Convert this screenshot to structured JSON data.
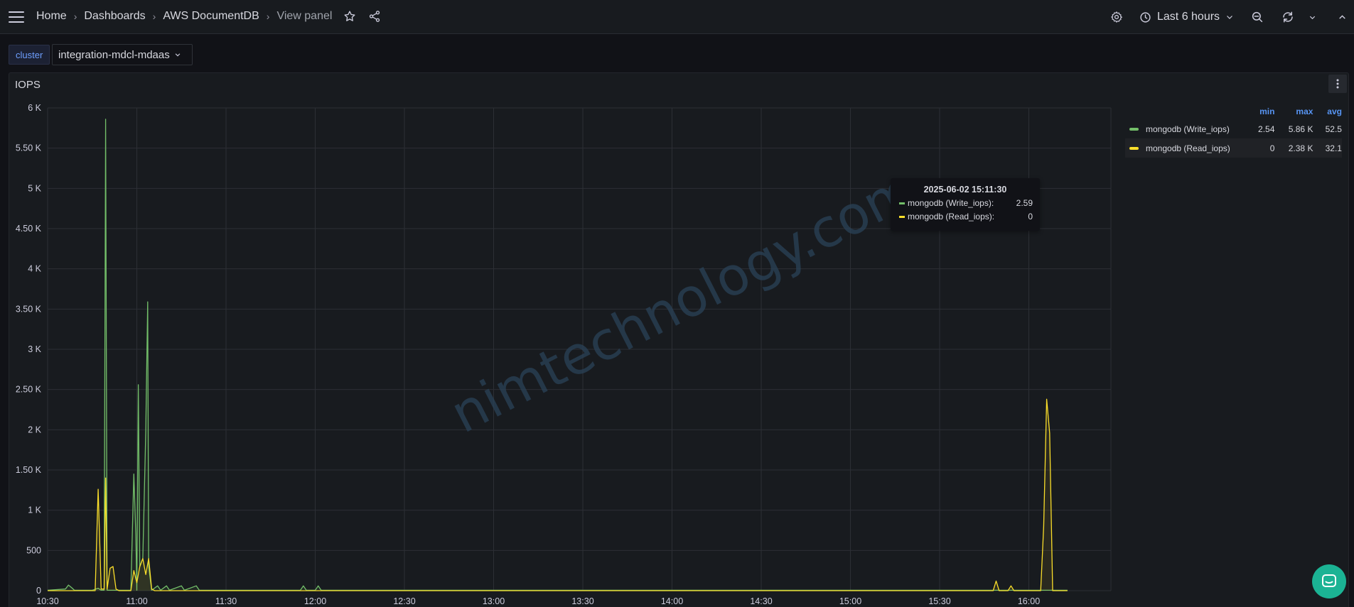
{
  "topbar": {
    "breadcrumbs": [
      {
        "label": "Home"
      },
      {
        "label": "Dashboards"
      },
      {
        "label": "AWS DocumentDB"
      },
      {
        "label": "View panel"
      }
    ],
    "time_range": "Last 6 hours"
  },
  "variables": {
    "label": "cluster",
    "value": "integration-mdcl-mdaas"
  },
  "panel": {
    "title": "IOPS"
  },
  "legend": {
    "headers": {
      "min": "min",
      "max": "max",
      "avg": "avg"
    },
    "rows": [
      {
        "name": "mongodb (Write_iops)",
        "min": "2.54",
        "max": "5.86 K",
        "avg": "52.5",
        "color": "#73bf69"
      },
      {
        "name": "mongodb (Read_iops)",
        "min": "0",
        "max": "2.38 K",
        "avg": "32.1",
        "color": "#fade2a"
      }
    ]
  },
  "tooltip": {
    "time": "2025-06-02 15:11:30",
    "rows": [
      {
        "name": "mongodb (Write_iops):",
        "value": "2.59",
        "color": "#73bf69"
      },
      {
        "name": "mongodb (Read_iops):",
        "value": "0",
        "color": "#fade2a"
      }
    ]
  },
  "watermark": "nimtechnology.com",
  "chart_data": {
    "type": "line",
    "x_tick_labels": [
      "10:30",
      "11:00",
      "11:30",
      "12:00",
      "12:30",
      "13:00",
      "13:30",
      "14:00",
      "14:30",
      "15:00",
      "15:30",
      "16:00"
    ],
    "y_tick_labels": [
      "0",
      "500",
      "1 K",
      "1.50 K",
      "2 K",
      "2.50 K",
      "3 K",
      "3.50 K",
      "4 K",
      "4.50 K",
      "5 K",
      "5.50 K",
      "6 K"
    ],
    "ylim": [
      0,
      6000
    ],
    "xlim": [
      "10:30",
      "16:15"
    ],
    "grid": true,
    "series": [
      {
        "name": "mongodb (Write_iops)",
        "color": "#73bf69",
        "points": [
          [
            "10:30",
            5
          ],
          [
            "10:36",
            20
          ],
          [
            "10:37",
            70
          ],
          [
            "10:38",
            40
          ],
          [
            "10:39",
            5
          ],
          [
            "10:45",
            5
          ],
          [
            "10:47",
            30
          ],
          [
            "10:48",
            5
          ],
          [
            "10:49",
            5
          ],
          [
            "10:49:30",
            5860
          ],
          [
            "10:50",
            5
          ],
          [
            "10:51",
            5
          ],
          [
            "10:58",
            5
          ],
          [
            "10:59",
            1450
          ],
          [
            "10:59:40",
            700
          ],
          [
            "11:00",
            5
          ],
          [
            "11:00:30",
            2560
          ],
          [
            "11:01",
            300
          ],
          [
            "11:02",
            400
          ],
          [
            "11:03",
            1990
          ],
          [
            "11:03:40",
            3590
          ],
          [
            "11:04",
            300
          ],
          [
            "11:05",
            5
          ],
          [
            "11:07",
            60
          ],
          [
            "11:08",
            5
          ],
          [
            "11:10",
            60
          ],
          [
            "11:11",
            5
          ],
          [
            "11:15",
            60
          ],
          [
            "11:16",
            5
          ],
          [
            "11:20",
            60
          ],
          [
            "11:21",
            5
          ],
          [
            "11:55",
            5
          ],
          [
            "11:56",
            60
          ],
          [
            "11:57",
            5
          ],
          [
            "12:00",
            5
          ],
          [
            "12:01",
            60
          ],
          [
            "12:02",
            5
          ],
          [
            "16:13",
            5
          ]
        ]
      },
      {
        "name": "mongodb (Read_iops)",
        "color": "#fade2a",
        "points": [
          [
            "10:30",
            0
          ],
          [
            "10:46",
            0
          ],
          [
            "10:47",
            1260
          ],
          [
            "10:48",
            20
          ],
          [
            "10:49",
            20
          ],
          [
            "10:49:30",
            1400
          ],
          [
            "10:50",
            20
          ],
          [
            "10:51",
            280
          ],
          [
            "10:52",
            300
          ],
          [
            "10:53",
            20
          ],
          [
            "10:54",
            0
          ],
          [
            "10:58",
            0
          ],
          [
            "10:59",
            250
          ],
          [
            "11:00",
            100
          ],
          [
            "11:01",
            300
          ],
          [
            "11:02",
            400
          ],
          [
            "11:03",
            200
          ],
          [
            "11:04",
            400
          ],
          [
            "11:05",
            20
          ],
          [
            "11:06",
            0
          ],
          [
            "15:48",
            0
          ],
          [
            "15:49",
            120
          ],
          [
            "15:50",
            0
          ],
          [
            "15:53",
            0
          ],
          [
            "15:54",
            60
          ],
          [
            "15:55",
            0
          ],
          [
            "16:04",
            0
          ],
          [
            "16:05",
            800
          ],
          [
            "16:06",
            2380
          ],
          [
            "16:07",
            1960
          ],
          [
            "16:08",
            0
          ],
          [
            "16:13",
            0
          ]
        ]
      }
    ]
  }
}
